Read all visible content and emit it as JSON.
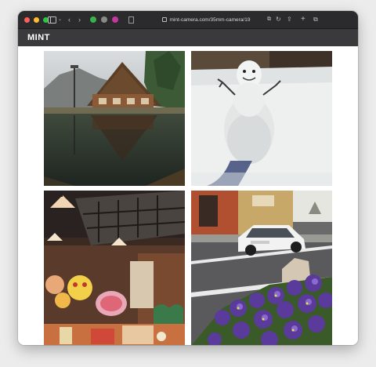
{
  "browser": {
    "url": "mint-camera.com/35mm-camera/19",
    "icons": [
      "close-light",
      "minimize-light",
      "maximize-light",
      "sidebar-icon",
      "chevron-down-icon",
      "back-icon",
      "forward-icon",
      "extension-green-icon",
      "extension-gray-icon",
      "extension-pink-icon",
      "page-icon",
      "lock-icon",
      "translate-icon",
      "reload-icon",
      "share-icon",
      "new-tab-icon",
      "tabs-icon"
    ]
  },
  "site": {
    "logo": "MINT"
  },
  "photos": [
    {
      "name": "photo-farmhouse-reflection"
    },
    {
      "name": "photo-snowman"
    },
    {
      "name": "photo-lantern-shop"
    },
    {
      "name": "photo-street-flowers"
    }
  ],
  "colors": {
    "titlebar": "#2b2b2d",
    "sitebar": "#3a3a3c",
    "close": "#ff5f57",
    "minimize": "#febc2e",
    "maximize": "#28c840"
  }
}
